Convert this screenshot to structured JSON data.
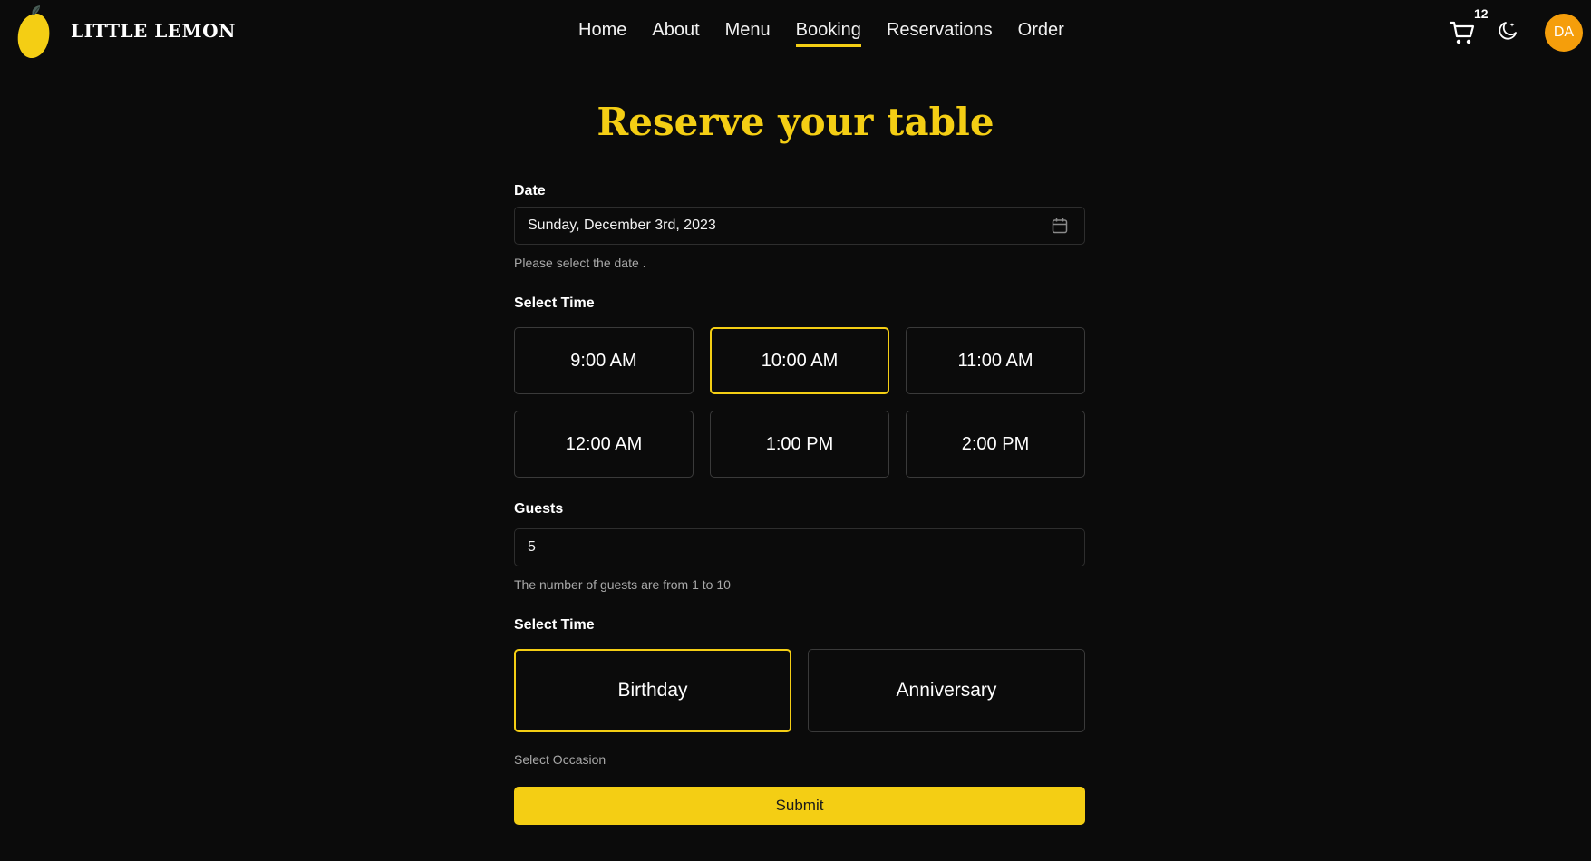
{
  "header": {
    "brand": "LITTLE LEMON",
    "nav": [
      {
        "label": "Home",
        "active": false
      },
      {
        "label": "About",
        "active": false
      },
      {
        "label": "Menu",
        "active": false
      },
      {
        "label": "Booking",
        "active": true
      },
      {
        "label": "Reservations",
        "active": false
      },
      {
        "label": "Order",
        "active": false
      }
    ],
    "cart_count": "12",
    "cart_icon": "cart-icon",
    "theme_icon": "theme-toggle-icon",
    "avatar_initials": "DA"
  },
  "colors": {
    "accent": "#f4ce14",
    "background": "#0b0b0b",
    "avatar": "#f59e0b"
  },
  "page": {
    "title": "Reserve your table"
  },
  "form": {
    "date_label": "Date",
    "date_value": "Sunday, December 3rd, 2023",
    "date_icon": "calendar-icon",
    "date_help": "Please select the date .",
    "time_label": "Select Time",
    "times": [
      {
        "label": "9:00 AM",
        "selected": false
      },
      {
        "label": "10:00 AM",
        "selected": true
      },
      {
        "label": "11:00 AM",
        "selected": false
      },
      {
        "label": "12:00 AM",
        "selected": false
      },
      {
        "label": "1:00 PM",
        "selected": false
      },
      {
        "label": "2:00 PM",
        "selected": false
      }
    ],
    "guests_label": "Guests",
    "guests_value": "5",
    "guests_help": "The number of guests are from 1 to 10",
    "occasion_label": "Select Time",
    "occasions": [
      {
        "label": "Birthday",
        "selected": true
      },
      {
        "label": "Anniversary",
        "selected": false
      }
    ],
    "occasion_help": "Select Occasion",
    "submit_label": "Submit"
  }
}
